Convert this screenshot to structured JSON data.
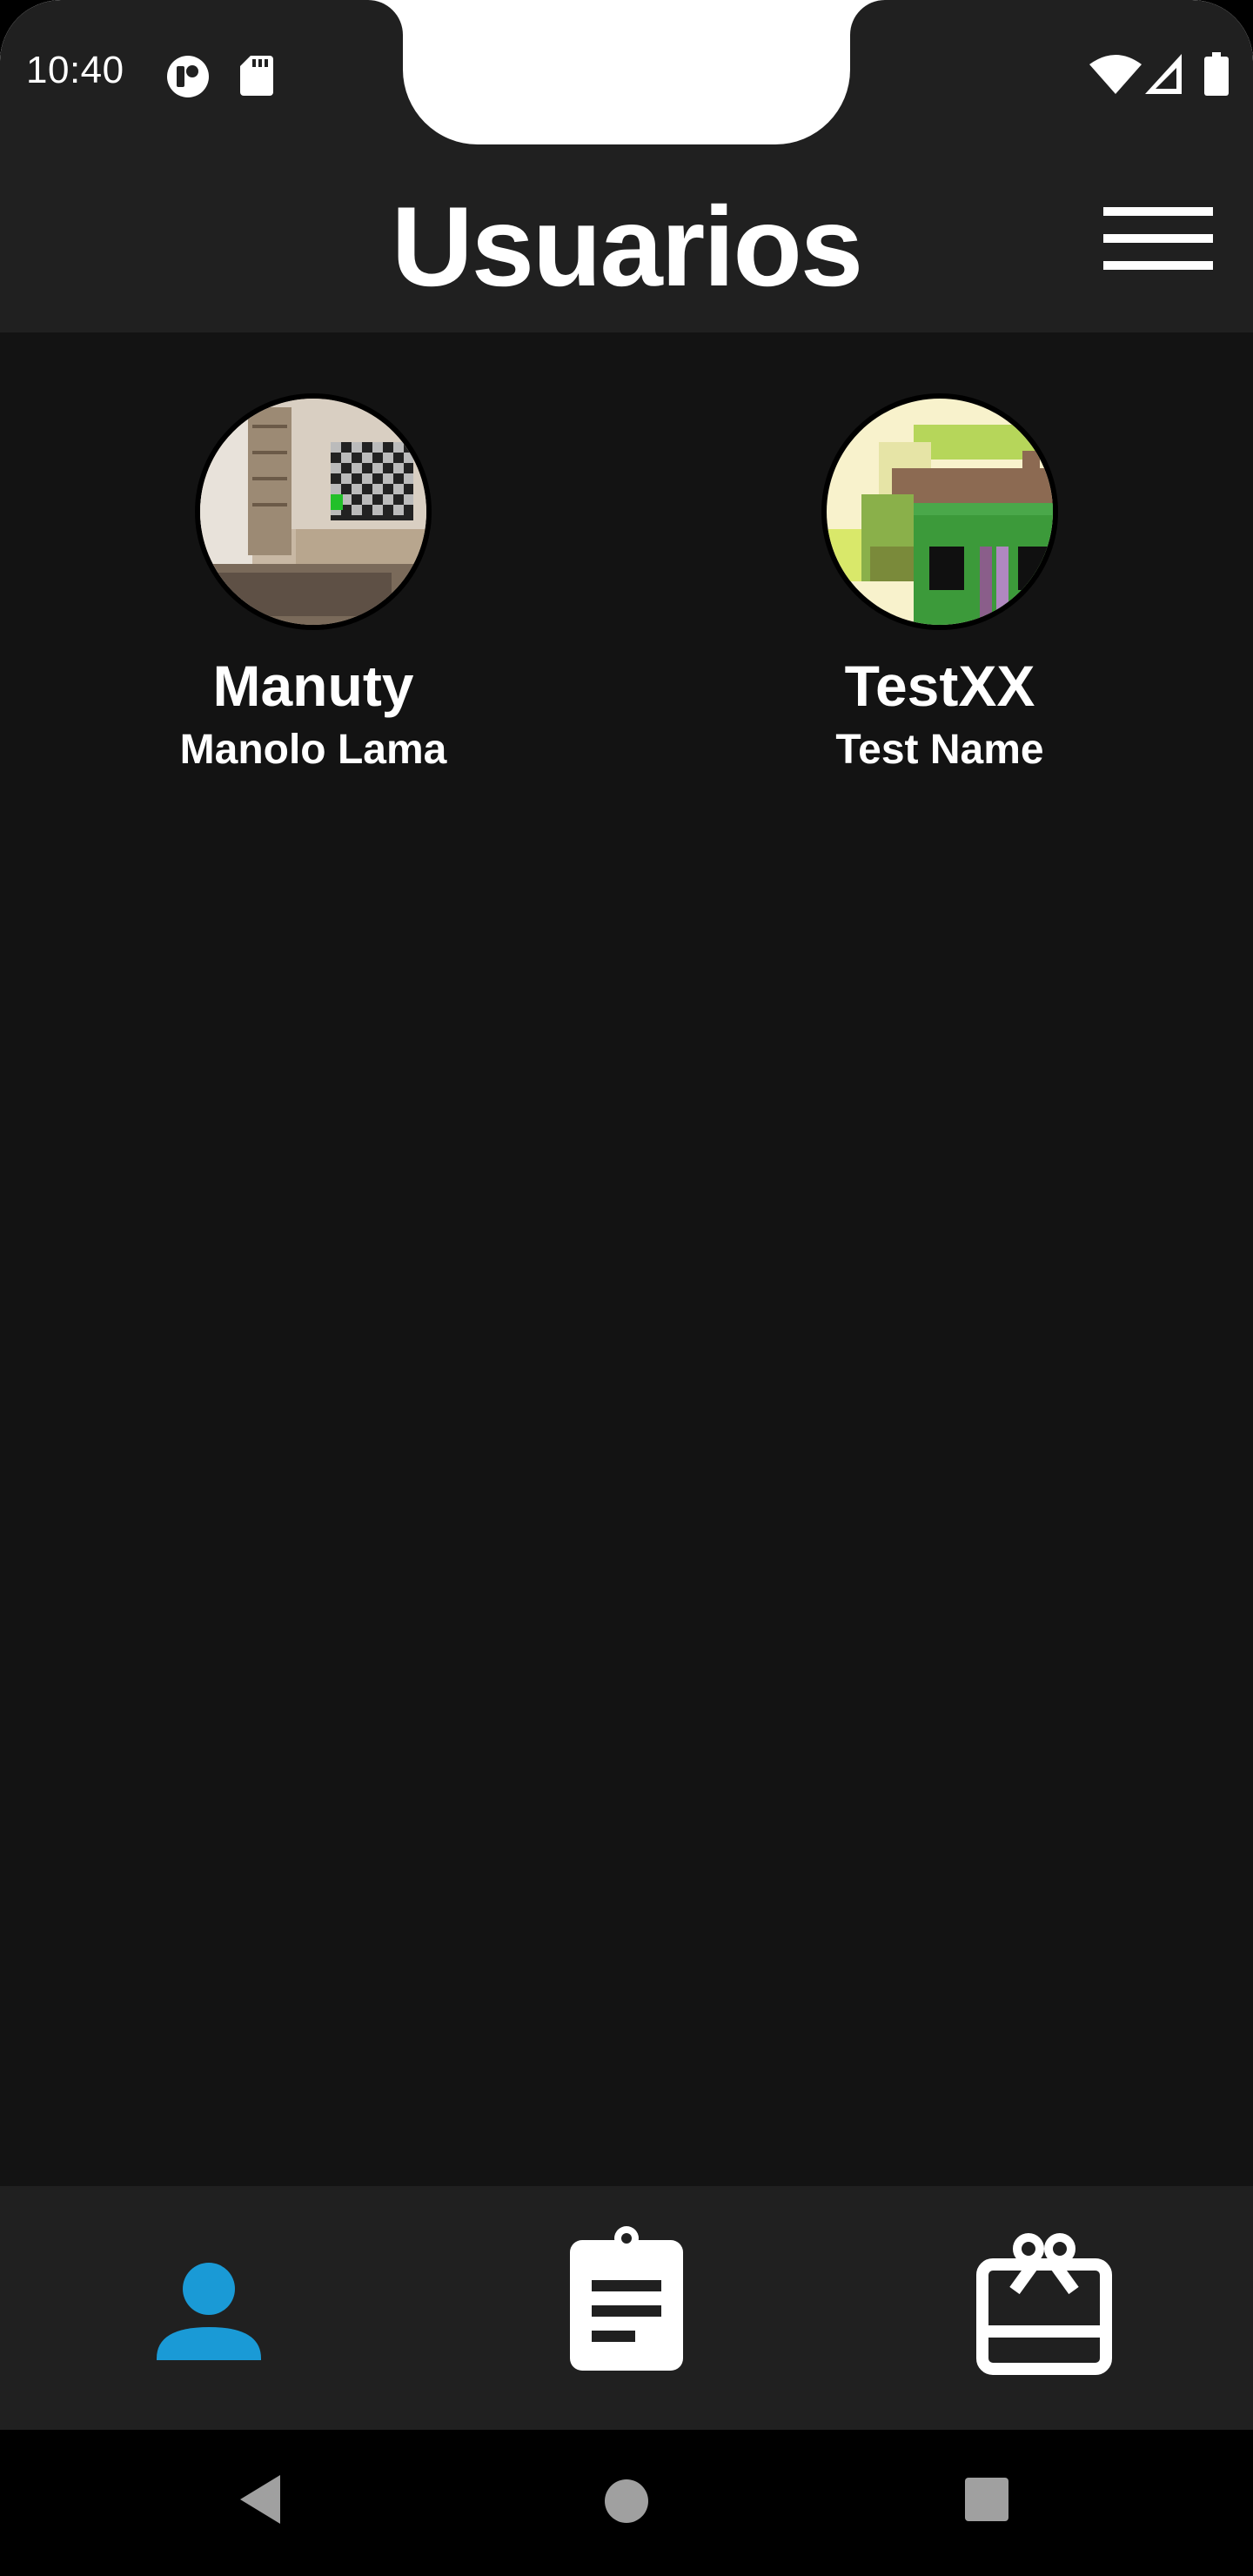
{
  "status_bar": {
    "time": "10:40",
    "left_icons": [
      "app-notification-icon",
      "sd-card-icon"
    ],
    "right_icons": [
      "wifi-icon",
      "cell-signal-icon",
      "battery-icon"
    ]
  },
  "header": {
    "title": "Usuarios",
    "menu_icon": "hamburger-menu-icon"
  },
  "users": [
    {
      "username": "Manuty",
      "name": "Manolo Lama",
      "avatar": "living-room-photo"
    },
    {
      "username": "TestXX",
      "name": "Test Name",
      "avatar": "pixel-art-image"
    }
  ],
  "bottom_nav": {
    "items": [
      {
        "icon": "person-icon",
        "active": true
      },
      {
        "icon": "clipboard-icon",
        "active": false
      },
      {
        "icon": "gift-card-icon",
        "active": false
      }
    ],
    "active_color": "#1a9ad6",
    "inactive_color": "#ffffff"
  },
  "system_nav": {
    "buttons": [
      "back-icon",
      "home-icon",
      "recents-icon"
    ]
  },
  "colors": {
    "background": "#131313",
    "bars": "#202020",
    "text": "#ffffff"
  }
}
